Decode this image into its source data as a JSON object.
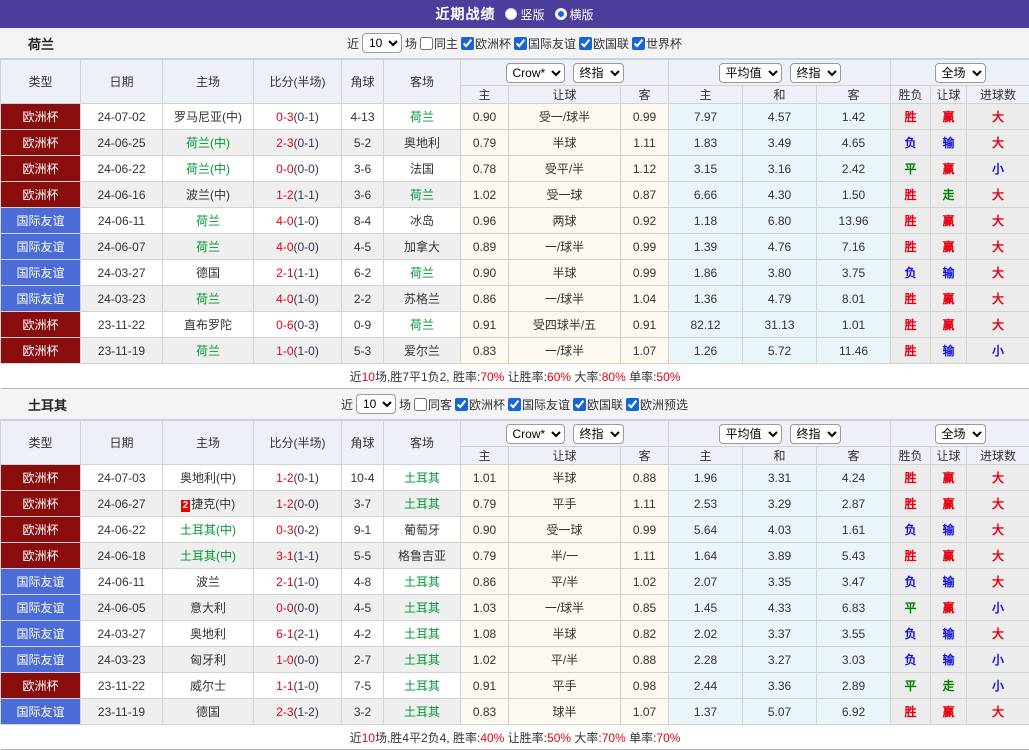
{
  "topbar": {
    "title": "近期战绩",
    "vertical_label": "竖版",
    "horizontal_label": "横版",
    "selected": "横版"
  },
  "table_header": {
    "static_cols": [
      "类型",
      "日期",
      "主场",
      "比分(半场)",
      "角球",
      "客场"
    ],
    "odds_dropdowns": [
      "Crow*",
      "终指"
    ],
    "odds_subs": [
      "主",
      "让球",
      "客"
    ],
    "avg_dropdowns": [
      "平均值",
      "终指"
    ],
    "avg_subs": [
      "主",
      "和",
      "客"
    ],
    "result_dropdown": "全场",
    "result_subs": [
      "胜负",
      "让球",
      "进球数"
    ]
  },
  "colors": {
    "topbar_bg": "#4c3e9c",
    "focus_team": "#009933",
    "league": {
      "欧洲杯": "#8a0d0d",
      "国际友谊": "#4b6cd6"
    },
    "result": {
      "胜": "#e60012",
      "平": "#008000",
      "负": "#1414e6",
      "赢": "#e60012",
      "走": "#008000",
      "输": "#1414e6",
      "大": "#e60012",
      "小": "#1414e6"
    }
  },
  "filter_labels": {
    "near": "近",
    "matches": "场",
    "count": "10"
  },
  "sections": [
    {
      "team": "荷兰",
      "filter": {
        "same_label": "同主",
        "same_checked": false,
        "leagues": [
          "欧洲杯",
          "国际友谊",
          "欧国联",
          "世界杯"
        ]
      },
      "rows": [
        {
          "league": "欧洲杯",
          "date": "24-07-02",
          "home": "罗马尼亚(中)",
          "hf": false,
          "rc": "",
          "score": "0-3",
          "half": "(0-1)",
          "corners": "4-13",
          "away": "荷兰",
          "af": true,
          "o1": "0.90",
          "hcp": "受一/球半",
          "o2": "0.99",
          "a1": "7.97",
          "a2": "4.57",
          "a3": "1.42",
          "r1": "胜",
          "r2": "赢",
          "r3": "大"
        },
        {
          "league": "欧洲杯",
          "date": "24-06-25",
          "home": "荷兰(中)",
          "hf": true,
          "rc": "",
          "score": "2-3",
          "half": "(0-1)",
          "corners": "5-2",
          "away": "奥地利",
          "af": false,
          "o1": "0.79",
          "hcp": "半球",
          "o2": "1.11",
          "a1": "1.83",
          "a2": "3.49",
          "a3": "4.65",
          "r1": "负",
          "r2": "输",
          "r3": "大"
        },
        {
          "league": "欧洲杯",
          "date": "24-06-22",
          "home": "荷兰(中)",
          "hf": true,
          "rc": "",
          "score": "0-0",
          "half": "(0-0)",
          "corners": "3-6",
          "away": "法国",
          "af": false,
          "o1": "0.78",
          "hcp": "受平/半",
          "o2": "1.12",
          "a1": "3.15",
          "a2": "3.16",
          "a3": "2.42",
          "r1": "平",
          "r2": "赢",
          "r3": "小"
        },
        {
          "league": "欧洲杯",
          "date": "24-06-16",
          "home": "波兰(中)",
          "hf": false,
          "rc": "",
          "score": "1-2",
          "half": "(1-1)",
          "corners": "3-6",
          "away": "荷兰",
          "af": true,
          "o1": "1.02",
          "hcp": "受一球",
          "o2": "0.87",
          "a1": "6.66",
          "a2": "4.30",
          "a3": "1.50",
          "r1": "胜",
          "r2": "走",
          "r3": "大"
        },
        {
          "league": "国际友谊",
          "date": "24-06-11",
          "home": "荷兰",
          "hf": true,
          "rc": "",
          "score": "4-0",
          "half": "(1-0)",
          "corners": "8-4",
          "away": "冰岛",
          "af": false,
          "o1": "0.96",
          "hcp": "两球",
          "o2": "0.92",
          "a1": "1.18",
          "a2": "6.80",
          "a3": "13.96",
          "r1": "胜",
          "r2": "赢",
          "r3": "大"
        },
        {
          "league": "国际友谊",
          "date": "24-06-07",
          "home": "荷兰",
          "hf": true,
          "rc": "",
          "score": "4-0",
          "half": "(0-0)",
          "corners": "4-5",
          "away": "加拿大",
          "af": false,
          "o1": "0.89",
          "hcp": "一/球半",
          "o2": "0.99",
          "a1": "1.39",
          "a2": "4.76",
          "a3": "7.16",
          "r1": "胜",
          "r2": "赢",
          "r3": "大"
        },
        {
          "league": "国际友谊",
          "date": "24-03-27",
          "home": "德国",
          "hf": false,
          "rc": "",
          "score": "2-1",
          "half": "(1-1)",
          "corners": "6-2",
          "away": "荷兰",
          "af": true,
          "o1": "0.90",
          "hcp": "半球",
          "o2": "0.99",
          "a1": "1.86",
          "a2": "3.80",
          "a3": "3.75",
          "r1": "负",
          "r2": "输",
          "r3": "大"
        },
        {
          "league": "国际友谊",
          "date": "24-03-23",
          "home": "荷兰",
          "hf": true,
          "rc": "",
          "score": "4-0",
          "half": "(1-0)",
          "corners": "2-2",
          "away": "苏格兰",
          "af": false,
          "o1": "0.86",
          "hcp": "一/球半",
          "o2": "1.04",
          "a1": "1.36",
          "a2": "4.79",
          "a3": "8.01",
          "r1": "胜",
          "r2": "赢",
          "r3": "大"
        },
        {
          "league": "欧洲杯",
          "date": "23-11-22",
          "home": "直布罗陀",
          "hf": false,
          "rc": "",
          "score": "0-6",
          "half": "(0-3)",
          "corners": "0-9",
          "away": "荷兰",
          "af": true,
          "o1": "0.91",
          "hcp": "受四球半/五",
          "o2": "0.91",
          "a1": "82.12",
          "a2": "31.13",
          "a3": "1.01",
          "r1": "胜",
          "r2": "赢",
          "r3": "大"
        },
        {
          "league": "欧洲杯",
          "date": "23-11-19",
          "home": "荷兰",
          "hf": true,
          "rc": "",
          "score": "1-0",
          "half": "(1-0)",
          "corners": "5-3",
          "away": "爱尔兰",
          "af": false,
          "o1": "0.83",
          "hcp": "一/球半",
          "o2": "1.07",
          "a1": "1.26",
          "a2": "5.72",
          "a3": "11.46",
          "r1": "胜",
          "r2": "输",
          "r3": "小"
        }
      ],
      "summary": [
        {
          "t": "近"
        },
        {
          "t": "10",
          "red": true
        },
        {
          "t": "场,胜7平1负2, 胜率:"
        },
        {
          "t": "70%",
          "red": true
        },
        {
          "t": " 让胜率:"
        },
        {
          "t": "60%",
          "red": true
        },
        {
          "t": " 大率:"
        },
        {
          "t": "80%",
          "red": true
        },
        {
          "t": " 单率:"
        },
        {
          "t": "50%",
          "red": true
        }
      ]
    },
    {
      "team": "土耳其",
      "filter": {
        "same_label": "同客",
        "same_checked": false,
        "leagues": [
          "欧洲杯",
          "国际友谊",
          "欧国联",
          "欧洲预选"
        ]
      },
      "rows": [
        {
          "league": "欧洲杯",
          "date": "24-07-03",
          "home": "奥地利(中)",
          "hf": false,
          "rc": "",
          "score": "1-2",
          "half": "(0-1)",
          "corners": "10-4",
          "away": "土耳其",
          "af": true,
          "o1": "1.01",
          "hcp": "半球",
          "o2": "0.88",
          "a1": "1.96",
          "a2": "3.31",
          "a3": "4.24",
          "r1": "胜",
          "r2": "赢",
          "r3": "大"
        },
        {
          "league": "欧洲杯",
          "date": "24-06-27",
          "home": "捷克(中)",
          "hf": false,
          "rc": "2",
          "score": "1-2",
          "half": "(0-0)",
          "corners": "3-7",
          "away": "土耳其",
          "af": true,
          "o1": "0.79",
          "hcp": "平手",
          "o2": "1.11",
          "a1": "2.53",
          "a2": "3.29",
          "a3": "2.87",
          "r1": "胜",
          "r2": "赢",
          "r3": "大"
        },
        {
          "league": "欧洲杯",
          "date": "24-06-22",
          "home": "土耳其(中)",
          "hf": true,
          "rc": "",
          "score": "0-3",
          "half": "(0-2)",
          "corners": "9-1",
          "away": "葡萄牙",
          "af": false,
          "o1": "0.90",
          "hcp": "受一球",
          "o2": "0.99",
          "a1": "5.64",
          "a2": "4.03",
          "a3": "1.61",
          "r1": "负",
          "r2": "输",
          "r3": "大"
        },
        {
          "league": "欧洲杯",
          "date": "24-06-18",
          "home": "土耳其(中)",
          "hf": true,
          "rc": "",
          "score": "3-1",
          "half": "(1-1)",
          "corners": "5-5",
          "away": "格鲁吉亚",
          "af": false,
          "o1": "0.79",
          "hcp": "半/一",
          "o2": "1.11",
          "a1": "1.64",
          "a2": "3.89",
          "a3": "5.43",
          "r1": "胜",
          "r2": "赢",
          "r3": "大"
        },
        {
          "league": "国际友谊",
          "date": "24-06-11",
          "home": "波兰",
          "hf": false,
          "rc": "",
          "score": "2-1",
          "half": "(1-0)",
          "corners": "4-8",
          "away": "土耳其",
          "af": true,
          "o1": "0.86",
          "hcp": "平/半",
          "o2": "1.02",
          "a1": "2.07",
          "a2": "3.35",
          "a3": "3.47",
          "r1": "负",
          "r2": "输",
          "r3": "大"
        },
        {
          "league": "国际友谊",
          "date": "24-06-05",
          "home": "意大利",
          "hf": false,
          "rc": "",
          "score": "0-0",
          "half": "(0-0)",
          "corners": "4-5",
          "away": "土耳其",
          "af": true,
          "o1": "1.03",
          "hcp": "一/球半",
          "o2": "0.85",
          "a1": "1.45",
          "a2": "4.33",
          "a3": "6.83",
          "r1": "平",
          "r2": "赢",
          "r3": "小"
        },
        {
          "league": "国际友谊",
          "date": "24-03-27",
          "home": "奥地利",
          "hf": false,
          "rc": "",
          "score": "6-1",
          "half": "(2-1)",
          "corners": "4-2",
          "away": "土耳其",
          "af": true,
          "o1": "1.08",
          "hcp": "半球",
          "o2": "0.82",
          "a1": "2.02",
          "a2": "3.37",
          "a3": "3.55",
          "r1": "负",
          "r2": "输",
          "r3": "大"
        },
        {
          "league": "国际友谊",
          "date": "24-03-23",
          "home": "匈牙利",
          "hf": false,
          "rc": "",
          "score": "1-0",
          "half": "(0-0)",
          "corners": "2-7",
          "away": "土耳其",
          "af": true,
          "o1": "1.02",
          "hcp": "平/半",
          "o2": "0.88",
          "a1": "2.28",
          "a2": "3.27",
          "a3": "3.03",
          "r1": "负",
          "r2": "输",
          "r3": "小"
        },
        {
          "league": "欧洲杯",
          "date": "23-11-22",
          "home": "威尔士",
          "hf": false,
          "rc": "",
          "score": "1-1",
          "half": "(1-0)",
          "corners": "7-5",
          "away": "土耳其",
          "af": true,
          "o1": "0.91",
          "hcp": "平手",
          "o2": "0.98",
          "a1": "2.44",
          "a2": "3.36",
          "a3": "2.89",
          "r1": "平",
          "r2": "走",
          "r3": "小"
        },
        {
          "league": "国际友谊",
          "date": "23-11-19",
          "home": "德国",
          "hf": false,
          "rc": "",
          "score": "2-3",
          "half": "(1-2)",
          "corners": "3-2",
          "away": "土耳其",
          "af": true,
          "o1": "0.83",
          "hcp": "球半",
          "o2": "1.07",
          "a1": "1.37",
          "a2": "5.07",
          "a3": "6.92",
          "r1": "胜",
          "r2": "赢",
          "r3": "大"
        }
      ],
      "summary": [
        {
          "t": "近"
        },
        {
          "t": "10",
          "red": true
        },
        {
          "t": "场,胜4平2负4, 胜率:"
        },
        {
          "t": "40%",
          "red": true
        },
        {
          "t": " 让胜率:"
        },
        {
          "t": "50%",
          "red": true
        },
        {
          "t": " 大率:"
        },
        {
          "t": "70%",
          "red": true
        },
        {
          "t": " 单率:"
        },
        {
          "t": "70%",
          "red": true
        }
      ]
    }
  ]
}
